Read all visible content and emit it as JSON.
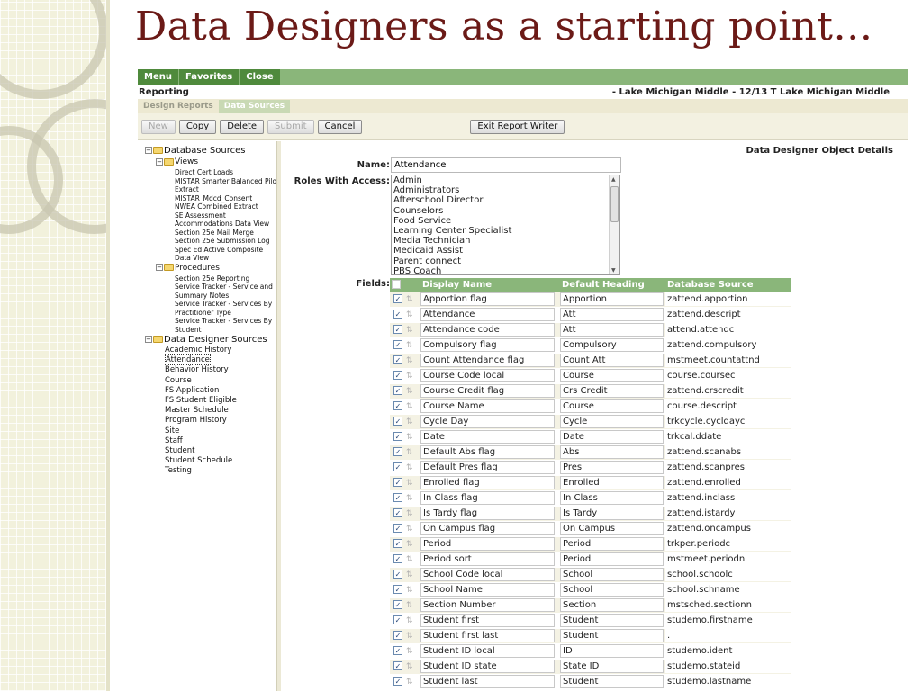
{
  "slide": {
    "title": "Data Designers as a starting point…"
  },
  "menu": {
    "items": [
      "Menu",
      "Favorites",
      "Close"
    ]
  },
  "report_bar": {
    "left": "Reporting",
    "right": "- Lake Michigan Middle - 12/13 T Lake Michigan Middle"
  },
  "tabs": [
    {
      "label": "Design Reports",
      "active": false
    },
    {
      "label": "Data Sources",
      "active": true
    }
  ],
  "toolbar": {
    "new": "New",
    "copy": "Copy",
    "delete": "Delete",
    "submit": "Submit",
    "cancel": "Cancel",
    "exit": "Exit Report Writer"
  },
  "tree": {
    "database_sources": "Database Sources",
    "views_label": "Views",
    "views": [
      "Direct Cert Loads",
      "MISTAR Smarter Balanced Pilot Extract",
      "MISTAR_Mdcd_Consent",
      "NWEA Combined Extract",
      "SE Assessment Accommodations Data View",
      "Section 25e Mail Merge",
      "Section 25e Submission Log",
      "Spec Ed Active Composite Data View"
    ],
    "procedures_label": "Procedures",
    "procedures": [
      "Section 25e Reporting",
      "Service Tracker - Service and Summary Notes",
      "Service Tracker - Services By Practitioner Type",
      "Service Tracker - Services By Student"
    ],
    "data_designer_sources": "Data Designer Sources",
    "designers": [
      "Academic History",
      "Attendance",
      "Behavior History",
      "Course",
      "FS Application",
      "FS Student Eligible",
      "Master Schedule",
      "Program History",
      "Site",
      "Staff",
      "Student",
      "Student Schedule",
      "Testing"
    ]
  },
  "details": {
    "title": "Data Designer Object Details",
    "name_label": "Name:",
    "name_value": "Attendance",
    "roles_label": "Roles With Access:",
    "roles": [
      "Admin",
      "Administrators",
      "Afterschool Director",
      "Counselors",
      "Food Service",
      "Learning Center Specialist",
      "Media Technician",
      "Medicaid Assist",
      "Parent connect",
      "PBS Coach"
    ],
    "fields_label": "Fields:"
  },
  "fields": {
    "headers": [
      "Display Name",
      "Default Heading",
      "Database Source"
    ],
    "rows": [
      [
        "Apportion flag",
        "Apportion",
        "zattend.apportion"
      ],
      [
        "Attendance",
        "Att",
        "zattend.descript"
      ],
      [
        "Attendance code",
        "Att",
        "attend.attendc"
      ],
      [
        "Compulsory flag",
        "Compulsory",
        "zattend.compulsory"
      ],
      [
        "Count Attendance flag",
        "Count Att",
        "mstmeet.countattnd"
      ],
      [
        "Course Code local",
        "Course",
        "course.coursec"
      ],
      [
        "Course Credit flag",
        "Crs Credit",
        "zattend.crscredit"
      ],
      [
        "Course Name",
        "Course",
        "course.descript"
      ],
      [
        "Cycle Day",
        "Cycle",
        "trkcycle.cycldayc"
      ],
      [
        "Date",
        "Date",
        "trkcal.ddate"
      ],
      [
        "Default Abs flag",
        "Abs",
        "zattend.scanabs"
      ],
      [
        "Default Pres flag",
        "Pres",
        "zattend.scanpres"
      ],
      [
        "Enrolled flag",
        "Enrolled",
        "zattend.enrolled"
      ],
      [
        "In Class flag",
        "In Class",
        "zattend.inclass"
      ],
      [
        "Is Tardy flag",
        "Is Tardy",
        "zattend.istardy"
      ],
      [
        "On Campus flag",
        "On Campus",
        "zattend.oncampus"
      ],
      [
        "Period",
        "Period",
        "trkper.periodc"
      ],
      [
        "Period sort",
        "Period",
        "mstmeet.periodn"
      ],
      [
        "School Code local",
        "School",
        "school.schoolc"
      ],
      [
        "School Name",
        "School",
        "school.schname"
      ],
      [
        "Section Number",
        "Section",
        "mstsched.sectionn"
      ],
      [
        "Student first",
        "Student",
        "studemo.firstname"
      ],
      [
        "Student first last",
        "Student",
        "."
      ],
      [
        "Student ID local",
        "ID",
        "studemo.ident"
      ],
      [
        "Student ID state",
        "State ID",
        "studemo.stateid"
      ],
      [
        "Student last",
        "Student",
        "studemo.lastname"
      ]
    ]
  },
  "colors": {
    "title": "#6b1a17",
    "menu_green": "#4f8a3c",
    "header_green": "#8ab67a"
  }
}
